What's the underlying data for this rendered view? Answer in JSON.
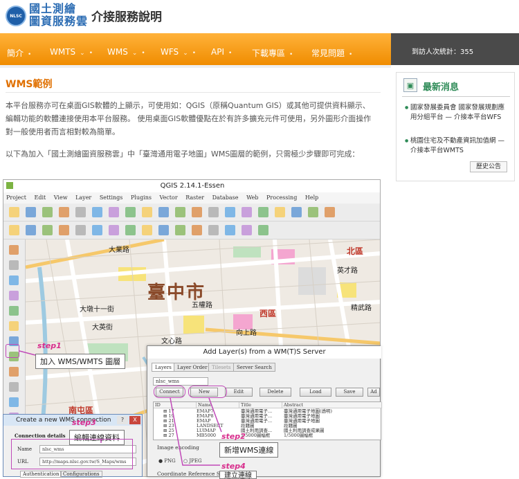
{
  "header": {
    "logo_badge": "NLSC",
    "logo_line1": "國土測繪",
    "logo_line2": "圖資服務雲",
    "title": "介接服務說明"
  },
  "nav": {
    "items": [
      "簡介",
      "WMTS",
      "WMS",
      "WFS",
      "API",
      "下載專區",
      "常見問題"
    ],
    "visitor_label": "到訪人次統計：",
    "visitor_count": "355"
  },
  "main": {
    "section_title": "WMS範例",
    "paragraph1": "本平台服務亦可在桌面GIS軟體的上顯示，可使用如：QGIS（原稱Quantum GIS）或其他可提供資料顯示、編輯功能的軟體連接使用本平台服務。 使用桌面GIS軟體優點在於有許多擴充元件可使用，另外圖形介面操作對一般使用者而言相對較為簡單。",
    "paragraph2": "以下為加入「國土測繪圖資服務雲」中「臺灣通用電子地圖」WMS圖層的範例，只需極少步驟即可完成："
  },
  "sidebar": {
    "title": "最新消息",
    "news": [
      "國家發展委員會 國家發展規劃應用分組平台 — 介接本平台WFS",
      "桃園住宅及不動產資訊加值網 — 介接本平台WMTS"
    ],
    "history_button": "歷史公告"
  },
  "screenshot": {
    "app_title": "QGIS 2.14.1-Essen",
    "menu": [
      "Project",
      "Edit",
      "View",
      "Layer",
      "Settings",
      "Plugins",
      "Vector",
      "Raster",
      "Database",
      "Web",
      "Processing",
      "Help"
    ],
    "map_city": "臺中市",
    "map_labels": [
      "北區",
      "西區",
      "南屯區",
      "大業路",
      "大墩十一街",
      "大英街",
      "向上路",
      "五權路",
      "英才路",
      "精武路",
      "文心路"
    ],
    "dialog_title": "Add Layer(s) from a WM(T)S Server",
    "dialog_tabs": [
      "Layers",
      "Layer Order",
      "Tilesets",
      "Server Search"
    ],
    "connection_value": "nlsc_wms",
    "dialog_buttons": [
      "Connect",
      "New",
      "Edit",
      "Delete",
      "Load",
      "Save",
      "Ad"
    ],
    "table_headers": [
      "ID",
      "Name",
      "Title",
      "Abstract"
    ],
    "table_rows": [
      {
        "id": "17",
        "name": "EMAP7",
        "title": "臺灣通用電子...",
        "abstract": "臺灣通用電子地圖(透明)"
      },
      {
        "id": "19",
        "name": "EMAP8",
        "title": "臺灣通用電子...",
        "abstract": "臺灣通用電子地圖"
      },
      {
        "id": "21",
        "name": "EMAP",
        "title": "臺灣通用電子...",
        "abstract": "臺灣通用電子地圖"
      },
      {
        "id": "23",
        "name": "LANDSECT",
        "title": "段籍圖",
        "abstract": "段籍圖"
      },
      {
        "id": "25",
        "name": "LUIMAP",
        "title": "國土利用調查...",
        "abstract": "國土利用調查成果圖"
      },
      {
        "id": "27",
        "name": "MB5000",
        "title": "1/5000圖幅框",
        "abstract": "1/5000圖幅框"
      }
    ],
    "image_encoding_label": "Image encoding",
    "encoding_options": [
      "PNG",
      "JPEG"
    ],
    "crs_label": "Coordinate Reference Sys...",
    "create_dialog_title": "Create a new WMS connection",
    "create_dialog_help": "?",
    "create_dialog_close": "X",
    "connection_details_label": "Connection details",
    "name_label": "Name",
    "name_value": "nlsc_wms",
    "url_label": "URL",
    "url_value": "http://maps.nlsc.gov.tw/S_Maps/wms",
    "create_tabs": [
      "Authentication",
      "Configurations"
    ]
  },
  "steps": {
    "step1": {
      "label": "step1",
      "text": "加入 WMS/WMTS 圖層"
    },
    "step2": {
      "label": "step2",
      "text": "新增WMS連線"
    },
    "step3": {
      "label": "step3",
      "text": "編輯連線資料"
    },
    "step4": {
      "label": "step4",
      "text": "建立連線"
    }
  },
  "colors": {
    "nav_orange": "#f08c00",
    "accent_orange": "#e07000",
    "news_green": "#2e8b57",
    "step_pink": "#d82e8d",
    "stat_bar": "#4a4a4a"
  }
}
